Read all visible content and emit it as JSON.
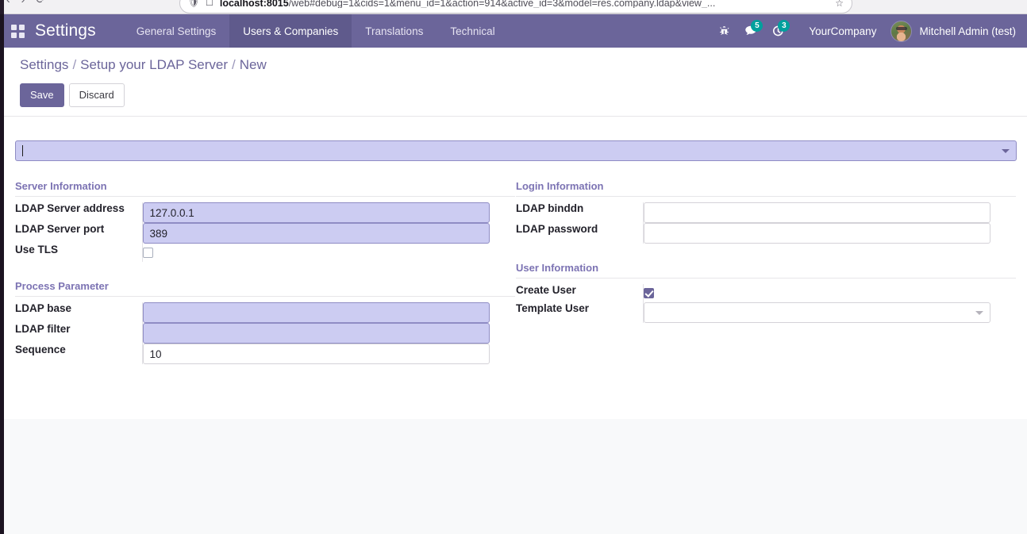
{
  "browser": {
    "back_icon": "back-arrow-icon",
    "forward_icon": "forward-arrow-icon",
    "reload_icon": "reload-icon",
    "shield_icon": "shield-icon",
    "reader_icon": "reader-view-icon",
    "bookmark_icon": "bookmark-star-icon",
    "url_host": "localhost:8015",
    "url_path": "/web#debug=1&cids=1&menu_id=1&action=914&active_id=3&model=res.company.ldap&view_..."
  },
  "navbar": {
    "apps_icon": "apps-grid-icon",
    "brand": "Settings",
    "menus": [
      {
        "label": "General Settings",
        "active": false
      },
      {
        "label": "Users & Companies",
        "active": true
      },
      {
        "label": "Translations",
        "active": false
      },
      {
        "label": "Technical",
        "active": false
      }
    ],
    "debug_icon": "bug-icon",
    "messages_icon": "chat-bubble-icon",
    "messages_count": "5",
    "activities_icon": "activity-clock-icon",
    "activities_count": "3",
    "company": "YourCompany",
    "avatar_icon": "user-avatar",
    "user": "Mitchell Admin (test)",
    "accent": "#6b659a",
    "accent_active": "#5f5a8c",
    "badge_color": "#00a09d"
  },
  "control_panel": {
    "breadcrumb": {
      "root": "Settings",
      "sep1": "/",
      "parent": "Setup your LDAP Server",
      "sep2": "/",
      "current": "New"
    },
    "save_label": "Save",
    "discard_label": "Discard"
  },
  "form": {
    "company_field": {
      "name": "company-select",
      "value": "",
      "placeholder": "",
      "caret_icon": "chevron-down-icon",
      "required": true
    },
    "groups": {
      "server_information": {
        "title": "Server Information",
        "fields": [
          {
            "label": "LDAP Server address",
            "value": "127.0.0.1",
            "type": "text",
            "required": true
          },
          {
            "label": "LDAP Server port",
            "value": "389",
            "type": "text",
            "required": true
          },
          {
            "label": "Use TLS",
            "value": "",
            "type": "checkbox",
            "checked": false
          }
        ]
      },
      "login_information": {
        "title": "Login Information",
        "fields": [
          {
            "label": "LDAP binddn",
            "value": "",
            "type": "text",
            "required": false
          },
          {
            "label": "LDAP password",
            "value": "",
            "type": "password",
            "required": false
          }
        ]
      },
      "process_parameter": {
        "title": "Process Parameter",
        "fields": [
          {
            "label": "LDAP base",
            "value": "",
            "type": "text",
            "required": true
          },
          {
            "label": "LDAP filter",
            "value": "",
            "type": "text",
            "required": true
          },
          {
            "label": "Sequence",
            "value": "10",
            "type": "text",
            "required": false
          }
        ]
      },
      "user_information": {
        "title": "User Information",
        "fields": [
          {
            "label": "Create User",
            "value": "",
            "type": "checkbox",
            "checked": true
          },
          {
            "label": "Template User",
            "value": "",
            "type": "select",
            "caret_icon": "chevron-down-icon"
          }
        ]
      }
    }
  },
  "colors": {
    "required_field_bg": "#ccccf2",
    "required_field_border": "#8f8cc4",
    "group_title": "#7c73b3",
    "sheet_bg": "#ffffff",
    "page_bg": "#f8f9fa"
  }
}
